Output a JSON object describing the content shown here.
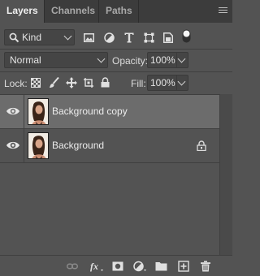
{
  "tabs": [
    {
      "label": "Layers",
      "active": true
    },
    {
      "label": "Channels",
      "active": false
    },
    {
      "label": "Paths",
      "active": false
    }
  ],
  "filter": {
    "kind_label": "Kind",
    "filter_icons": [
      "image-filter-icon",
      "adjustment-filter-icon",
      "type-filter-icon",
      "shape-filter-icon",
      "smart-object-filter-icon"
    ]
  },
  "blend": {
    "mode": "Normal",
    "opacity_label": "Opacity:",
    "opacity_value": "100%"
  },
  "lock": {
    "label": "Lock:",
    "fill_label": "Fill:",
    "fill_value": "100%"
  },
  "layers": [
    {
      "name": "Background copy",
      "visible": true,
      "selected": true,
      "locked": false
    },
    {
      "name": "Background",
      "visible": true,
      "selected": false,
      "locked": true
    }
  ],
  "footer_icons": [
    "link-layers-icon",
    "layer-style-fx-icon",
    "add-mask-icon",
    "new-adjustment-layer-icon",
    "new-group-icon",
    "new-layer-icon",
    "delete-layer-icon"
  ],
  "colors": {
    "panel": "#535353",
    "tabbar": "#3c3c3c",
    "selected_row": "#6c6c6c",
    "field": "#454545"
  }
}
